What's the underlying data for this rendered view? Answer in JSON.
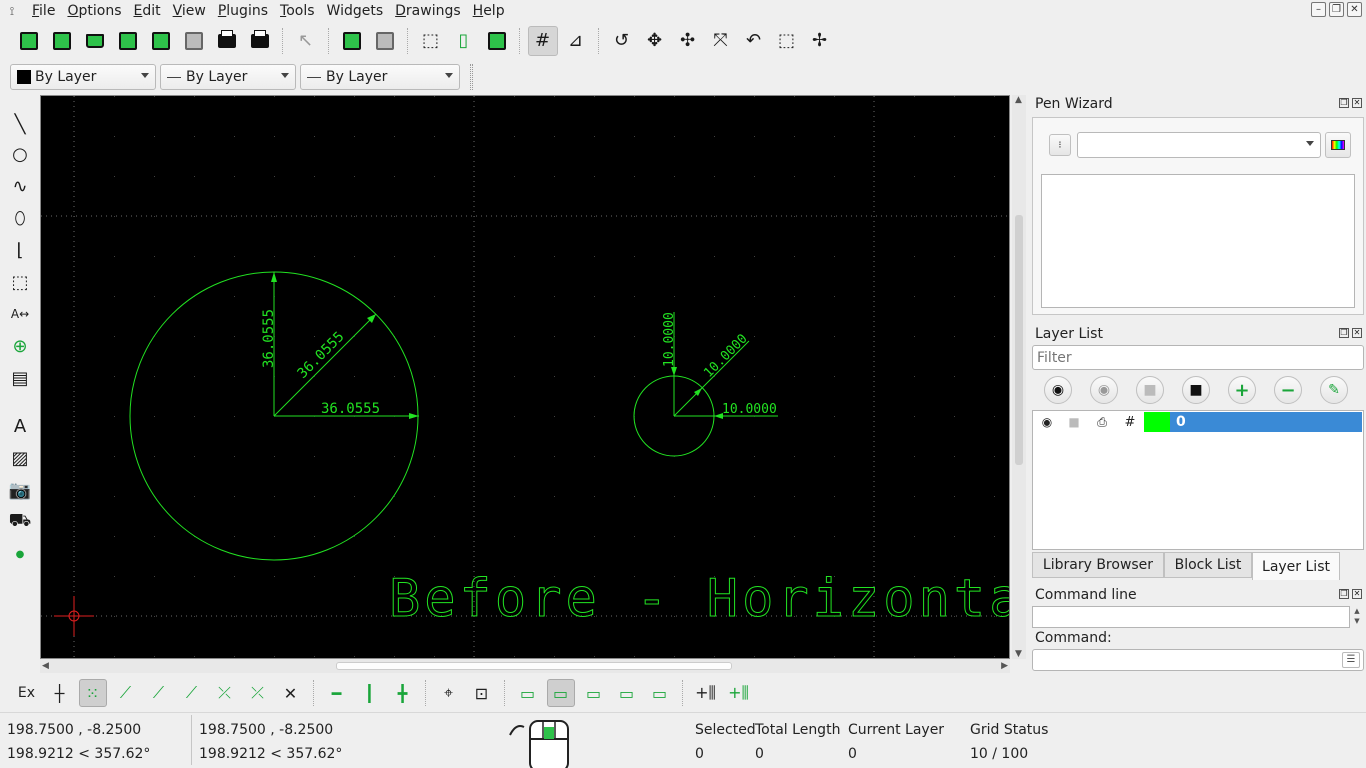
{
  "menubar": {
    "items": [
      {
        "label": "File",
        "u": "F",
        "rest": "ile"
      },
      {
        "label": "Options",
        "u": "O",
        "rest": "ptions"
      },
      {
        "label": "Edit",
        "u": "E",
        "rest": "dit"
      },
      {
        "label": "View",
        "u": "V",
        "rest": "iew"
      },
      {
        "label": "Plugins",
        "u": "P",
        "rest": "lugins"
      },
      {
        "label": "Tools",
        "u": "T",
        "rest": "ools"
      },
      {
        "label": "Widgets",
        "u": "",
        "rest": "Widgets"
      },
      {
        "label": "Drawings",
        "u": "D",
        "rest": "rawings"
      },
      {
        "label": "Help",
        "u": "H",
        "rest": "elp"
      }
    ]
  },
  "propbar": {
    "color": "By Layer",
    "width": "By Layer",
    "linetype": "By Layer"
  },
  "drawing": {
    "big_circle": {
      "radius_label": "36.0555",
      "diameter_label_vertical": "36.0555",
      "diagonal_label": "36.0555",
      "horizontal_label": "36.0555"
    },
    "small_circle": {
      "vertical_label": "10.0000",
      "diagonal_label": "10.0000",
      "horizontal_label": "10.0000"
    },
    "caption": "Before - Horizontal",
    "entity_color": "#22e222"
  },
  "dock": {
    "pen_wizard": {
      "title": "Pen Wizard"
    },
    "layer_list": {
      "title": "Layer List",
      "filter_placeholder": "Filter",
      "layers": [
        {
          "name": "0",
          "color": "#00ff00"
        }
      ]
    },
    "tabs": [
      "Library Browser",
      "Block List",
      "Layer List"
    ],
    "command_line": {
      "title": "Command line",
      "prompt": "Command:"
    }
  },
  "snapbar": {
    "ex_label": "Ex"
  },
  "status": {
    "rel_coords": "198.7500 , -8.2500",
    "rel_polar": "198.9212 < 357.62°",
    "abs_coords": "198.7500 , -8.2500",
    "abs_polar": "198.9212 < 357.62°",
    "selected_label": "Selected",
    "selected_value": "0",
    "total_length_label": "Total Length",
    "total_length_value": "0",
    "current_layer_label": "Current Layer",
    "current_layer_value": "0",
    "grid_status_label": "Grid Status",
    "grid_status_value": "10 / 100"
  }
}
